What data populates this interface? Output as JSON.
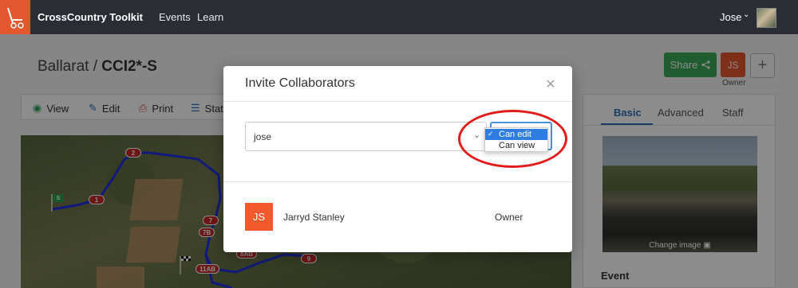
{
  "topbar": {
    "brand": "CrossCountry Toolkit",
    "nav": [
      "Events",
      "Learn"
    ],
    "user": "Jose",
    "logo_icon": "cart-logo-icon"
  },
  "page": {
    "title_event": "Ballarat / ",
    "title_class": "CCI2*-S",
    "share_label": "Share",
    "owner_initials": "JS",
    "owner_caption": "Owner",
    "add_label": "+"
  },
  "toolbar": {
    "items": [
      "View",
      "Edit",
      "Print",
      "Stat"
    ]
  },
  "map": {
    "markers": [
      "2",
      "1",
      "7",
      "7B",
      "8AB",
      "9",
      "11AB"
    ],
    "start_flag": "S"
  },
  "right_panel": {
    "tabs": [
      "Basic",
      "Advanced",
      "Staff"
    ],
    "photo_caption": "Change image",
    "event_label": "Event"
  },
  "modal": {
    "title": "Invite Collaborators",
    "close": "×",
    "invite_value": "jose",
    "permission_options": [
      {
        "label": "Can edit",
        "selected": true
      },
      {
        "label": "Can view",
        "selected": false
      }
    ],
    "collaborators": [
      {
        "initials": "JS",
        "name": "Jarryd Stanley",
        "role": "Owner"
      }
    ]
  },
  "colors": {
    "accent": "#2f6fbd",
    "share": "#3aa856",
    "avatar": "#e4572e",
    "highlight": "#e31b1b"
  }
}
